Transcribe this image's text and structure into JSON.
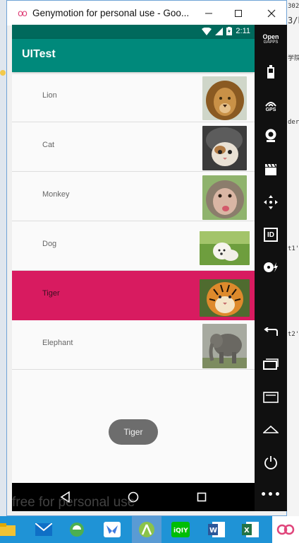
{
  "window": {
    "title": "Genymotion for personal use - Goo...",
    "logo_text": "oo",
    "minimize_label": "—",
    "maximize_label": "☐",
    "close_label": "✕"
  },
  "desktop": {
    "right_snippets": [
      "302",
      "3/b",
      "学院",
      "der",
      "t1'",
      "t2'"
    ],
    "left_snippet": "3"
  },
  "status_bar": {
    "time": "2:11"
  },
  "app_bar": {
    "title": "UITest"
  },
  "list": {
    "items": [
      {
        "label": "Lion",
        "selected": false
      },
      {
        "label": "Cat",
        "selected": false
      },
      {
        "label": "Monkey",
        "selected": false
      },
      {
        "label": "Dog",
        "selected": false
      },
      {
        "label": "Tiger",
        "selected": true
      },
      {
        "label": "Elephant",
        "selected": false
      }
    ]
  },
  "toast": {
    "text": "Tiger"
  },
  "tool_panel": {
    "opengapps_line1": "Open",
    "opengapps_line2": "GAPPS",
    "gps_label": "GPS",
    "id_label": "ID",
    "more_label": "•••"
  },
  "watermark": "free for personal use",
  "colors": {
    "accent": "#00897b",
    "status": "#00695c",
    "selected_row": "#d81b60",
    "taskbar": "#1f93d6"
  }
}
